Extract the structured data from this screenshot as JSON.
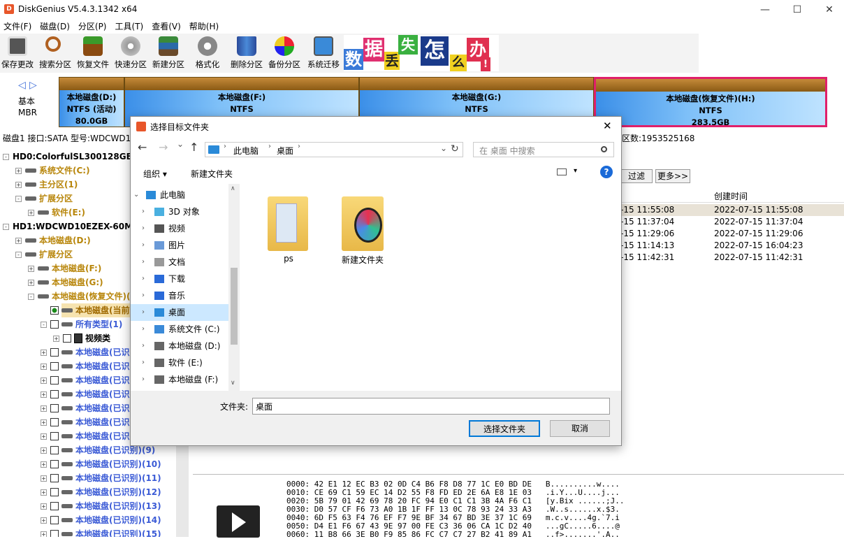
{
  "window": {
    "title": "DiskGenius V5.4.3.1342 x64",
    "icon_letter": "D",
    "minimize": "—",
    "maximize": "☐",
    "close": "✕"
  },
  "menu": [
    "文件(F)",
    "磁盘(D)",
    "分区(P)",
    "工具(T)",
    "查看(V)",
    "帮助(H)"
  ],
  "toolbar": [
    "保存更改",
    "搜索分区",
    "恢复文件",
    "快速分区",
    "新建分区",
    "格式化",
    "删除分区",
    "备份分区",
    "系统迁移"
  ],
  "banner": {
    "chars": [
      "数",
      "据",
      "丢",
      "失",
      "怎",
      "么",
      "办",
      "!"
    ]
  },
  "diskmap": {
    "nav_left": "◁",
    "nav_right": "▷",
    "left_label": [
      "基本",
      "MBR"
    ],
    "partitions": [
      {
        "name": "本地磁盘(D:)",
        "fs": "NTFS (活动)",
        "size": "80.0GB"
      },
      {
        "name": "本地磁盘(F:)",
        "fs": "NTFS",
        "size": ""
      },
      {
        "name": "本地磁盘(G:)",
        "fs": "NTFS",
        "size": ""
      },
      {
        "name": "本地磁盘(恢复文件)(H:)",
        "fs": "NTFS",
        "size": "283.5GB"
      }
    ]
  },
  "diskinfo": {
    "left": "磁盘1 接口:SATA  型号:WDCWD1",
    "right": "区数:1953525168"
  },
  "tree": {
    "items": [
      {
        "label": "HD0:ColorfulSL300128GB(1",
        "indent": 0,
        "pm": "-",
        "cls": "hd"
      },
      {
        "label": "系统文件(C:)",
        "indent": 1,
        "pm": "+",
        "cls": "org"
      },
      {
        "label": "主分区(1)",
        "indent": 1,
        "pm": "+",
        "cls": "org"
      },
      {
        "label": "扩展分区",
        "indent": 1,
        "pm": "-",
        "cls": "org"
      },
      {
        "label": "软件(E:)",
        "indent": 2,
        "pm": "+",
        "cls": "org"
      },
      {
        "label": "HD1:WDCWD10EZEX-60M2",
        "indent": 0,
        "pm": "-",
        "cls": "hd"
      },
      {
        "label": "本地磁盘(D:)",
        "indent": 1,
        "pm": "+",
        "cls": "org"
      },
      {
        "label": "扩展分区",
        "indent": 1,
        "pm": "-",
        "cls": "org"
      },
      {
        "label": "本地磁盘(F:)",
        "indent": 2,
        "pm": "+",
        "cls": "org"
      },
      {
        "label": "本地磁盘(G:)",
        "indent": 2,
        "pm": "+",
        "cls": "org"
      },
      {
        "label": "本地磁盘(恢复文件)(H:)",
        "indent": 2,
        "pm": "-",
        "cls": "org"
      },
      {
        "label": "本地磁盘(当前分区",
        "indent": 3,
        "pm": "",
        "cls": "cur"
      },
      {
        "label": "所有类型(1)",
        "indent": 3,
        "pm": "-",
        "cls": "blu"
      },
      {
        "label": "视频类",
        "indent": 4,
        "pm": "+",
        "cls": "vid"
      },
      {
        "label": "本地磁盘(已识别)",
        "indent": 3,
        "pm": "+",
        "cls": "blu"
      },
      {
        "label": "本地磁盘(已识别)",
        "indent": 3,
        "pm": "+",
        "cls": "blu"
      },
      {
        "label": "本地磁盘(已识别)",
        "indent": 3,
        "pm": "+",
        "cls": "blu"
      },
      {
        "label": "本地磁盘(已识别)",
        "indent": 3,
        "pm": "+",
        "cls": "blu"
      },
      {
        "label": "本地磁盘(已识别)",
        "indent": 3,
        "pm": "+",
        "cls": "blu"
      },
      {
        "label": "本地磁盘(已识别)",
        "indent": 3,
        "pm": "+",
        "cls": "blu"
      },
      {
        "label": "本地磁盘(已识别)",
        "indent": 3,
        "pm": "+",
        "cls": "blu"
      },
      {
        "label": "本地磁盘(已识别)(9)",
        "indent": 3,
        "pm": "+",
        "cls": "blu"
      },
      {
        "label": "本地磁盘(已识别)(10)",
        "indent": 3,
        "pm": "+",
        "cls": "blu"
      },
      {
        "label": "本地磁盘(已识别)(11)",
        "indent": 3,
        "pm": "+",
        "cls": "blu"
      },
      {
        "label": "本地磁盘(已识别)(12)",
        "indent": 3,
        "pm": "+",
        "cls": "blu"
      },
      {
        "label": "本地磁盘(已识别)(13)",
        "indent": 3,
        "pm": "+",
        "cls": "blu"
      },
      {
        "label": "本地磁盘(已识别)(14)",
        "indent": 3,
        "pm": "+",
        "cls": "blu"
      },
      {
        "label": "本地磁盘(已识别)(15)",
        "indent": 3,
        "pm": "+",
        "cls": "blu"
      }
    ]
  },
  "rightpanel": {
    "filter_btn": "过滤",
    "more_btn": "更多>>",
    "col_header": "创建时间",
    "rows": [
      {
        "modified": "-15 11:55:08",
        "created": "2022-07-15 11:55:08"
      },
      {
        "modified": "-15 11:37:04",
        "created": "2022-07-15 11:37:04"
      },
      {
        "modified": "-15 11:29:06",
        "created": "2022-07-15 11:29:06"
      },
      {
        "modified": "-15 11:14:13",
        "created": "2022-07-15 16:04:23"
      },
      {
        "modified": "-15 11:42:31",
        "created": "2022-07-15 11:42:31"
      }
    ]
  },
  "hex": [
    {
      "off": "0000:",
      "bytes": "42 E1 12 EC B3 02 0D C4 B6 F8 D8 77 1C E0 BD DE",
      "ascii": "B..........w...."
    },
    {
      "off": "0010:",
      "bytes": "CE 69 C1 59 EC 14 D2 55 F8 FD ED 2E 6A E8 1E 03",
      "ascii": ".i.Y...U....j..."
    },
    {
      "off": "0020:",
      "bytes": "5B 79 01 42 69 78 20 FC 94 E0 C1 C1 3B 4A F6 C1",
      "ascii": "[y.Bix ......;J.."
    },
    {
      "off": "0030:",
      "bytes": "D0 57 CF F6 73 A0 1B 1F FF 13 0C 78 93 24 33 A3",
      "ascii": ".W..s......x.$3."
    },
    {
      "off": "0040:",
      "bytes": "6D F5 63 F4 76 EF F7 9E BF 34 67 BD 3E 37 1C 69",
      "ascii": "m.c.v....4g.`7.i"
    },
    {
      "off": "0050:",
      "bytes": "D4 E1 F6 67 43 9E 97 00 FE C3 36 06 CA 1C D2 40",
      "ascii": "...gC.....6....@"
    },
    {
      "off": "0060:",
      "bytes": "11 B8 66 3E B0 F9 85 86 FC C7 C7 27 B2 41 89 A1",
      "ascii": "..f>.......'.A.."
    }
  ],
  "dialog": {
    "title": "选择目标文件夹",
    "close": "✕",
    "nav": {
      "back": "←",
      "forward": "→",
      "dropdown": "⌄",
      "up": "↑",
      "path": [
        "此电脑",
        "桌面"
      ],
      "sep": "›",
      "refresh": "↻",
      "search_placeholder": "在 桌面 中搜索"
    },
    "cmd": {
      "organize": "组织 ▾",
      "new_folder": "新建文件夹",
      "view": "▾",
      "help": "?"
    },
    "navpane": [
      {
        "label": "此电脑",
        "icon": "computer-icon",
        "expanded": true
      },
      {
        "label": "3D 对象",
        "icon": "cube-icon"
      },
      {
        "label": "视频",
        "icon": "video-icon"
      },
      {
        "label": "图片",
        "icon": "picture-icon"
      },
      {
        "label": "文档",
        "icon": "document-icon"
      },
      {
        "label": "下载",
        "icon": "download-icon"
      },
      {
        "label": "音乐",
        "icon": "music-icon"
      },
      {
        "label": "桌面",
        "icon": "desktop-icon",
        "selected": true
      },
      {
        "label": "系统文件 (C:)",
        "icon": "windows-drive-icon"
      },
      {
        "label": "本地磁盘 (D:)",
        "icon": "drive-icon"
      },
      {
        "label": "软件 (E:)",
        "icon": "drive-icon"
      },
      {
        "label": "本地磁盘 (F:)",
        "icon": "drive-icon"
      }
    ],
    "folders": [
      "ps",
      "新建文件夹"
    ],
    "footer": {
      "folder_label": "文件夹:",
      "folder_value": "桌面",
      "select_btn": "选择文件夹",
      "cancel_btn": "取消"
    }
  },
  "colors": {
    "accent": "#0078d7",
    "partition_sel": "#e0206a",
    "tree_orange": "#b8860b",
    "tree_blue": "#3b5bd6"
  }
}
